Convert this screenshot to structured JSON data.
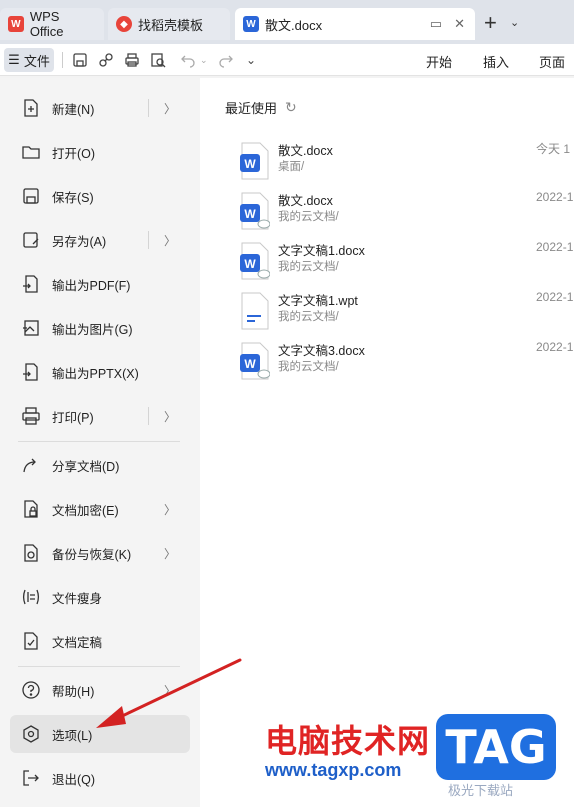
{
  "tabs": [
    {
      "label": "WPS Office",
      "icon": "wps-logo-icon"
    },
    {
      "label": "找稻壳模板",
      "icon": "docer-logo-icon"
    },
    {
      "label": "散文.docx",
      "icon": "word-doc-icon"
    }
  ],
  "toolbar": {
    "file_menu_label": "文件",
    "ribbon_tabs": [
      "开始",
      "插入",
      "页面"
    ]
  },
  "file_menu": {
    "items": [
      {
        "label": "新建(N)",
        "icon": "new-file-icon",
        "has_submenu": true
      },
      {
        "label": "打开(O)",
        "icon": "folder-open-icon",
        "has_submenu": false
      },
      {
        "label": "保存(S)",
        "icon": "save-icon",
        "has_submenu": false
      },
      {
        "label": "另存为(A)",
        "icon": "save-as-icon",
        "has_submenu": true
      },
      {
        "label": "输出为PDF(F)",
        "icon": "export-pdf-icon",
        "has_submenu": false
      },
      {
        "label": "输出为图片(G)",
        "icon": "export-image-icon",
        "has_submenu": false
      },
      {
        "label": "输出为PPTX(X)",
        "icon": "export-pptx-icon",
        "has_submenu": false
      },
      {
        "label": "打印(P)",
        "icon": "print-icon",
        "has_submenu": true
      },
      {
        "label": "分享文档(D)",
        "icon": "share-icon",
        "has_submenu": false
      },
      {
        "label": "文档加密(E)",
        "icon": "lock-file-icon",
        "has_submenu": true
      },
      {
        "label": "备份与恢复(K)",
        "icon": "backup-icon",
        "has_submenu": true
      },
      {
        "label": "文件瘦身",
        "icon": "file-slim-icon",
        "has_submenu": false
      },
      {
        "label": "文档定稿",
        "icon": "finalize-icon",
        "has_submenu": false
      },
      {
        "label": "帮助(H)",
        "icon": "help-icon",
        "has_submenu": true
      },
      {
        "label": "选项(L)",
        "icon": "settings-hexagon-icon",
        "has_submenu": false,
        "selected": true
      },
      {
        "label": "退出(Q)",
        "icon": "exit-icon",
        "has_submenu": false
      }
    ]
  },
  "recent": {
    "title": "最近使用",
    "files": [
      {
        "name": "散文.docx",
        "location": "桌面/",
        "date": "今天  1",
        "type": "docx"
      },
      {
        "name": "散文.docx",
        "location": "我的云文档/",
        "date": "2022-1",
        "type": "docx-cloud"
      },
      {
        "name": "文字文稿1.docx",
        "location": "我的云文档/",
        "date": "2022-1",
        "type": "docx-cloud"
      },
      {
        "name": "文字文稿1.wpt",
        "location": "我的云文档/",
        "date": "2022-1",
        "type": "wpt"
      },
      {
        "name": "文字文稿3.docx",
        "location": "我的云文档/",
        "date": "2022-1",
        "type": "docx-cloud"
      }
    ]
  },
  "watermark": {
    "site_name": "电脑技术网",
    "url": "www.tagxp.com",
    "badge": "TAG",
    "sub": "极光下载站"
  },
  "colors": {
    "accent_blue": "#2b66d8",
    "arrow_red": "#d32222",
    "watermark_red": "#e02424",
    "watermark_blue": "#1f6fe0"
  }
}
